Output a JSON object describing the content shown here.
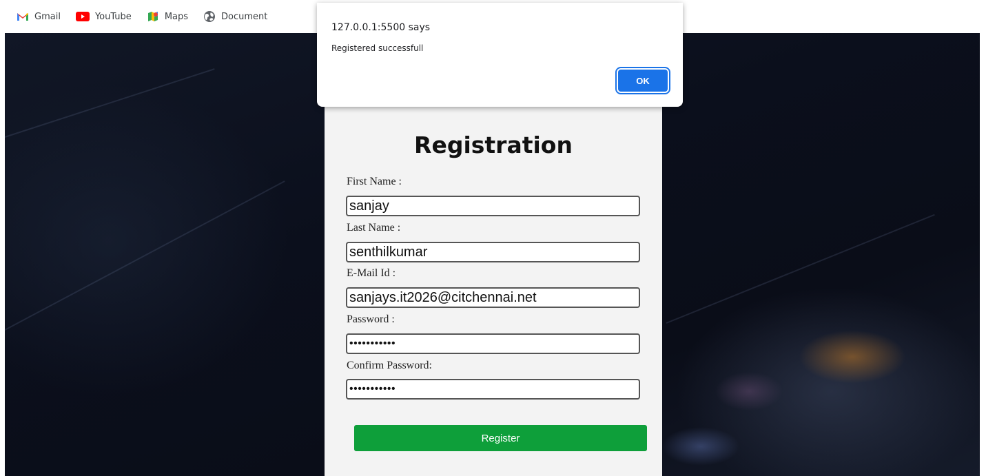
{
  "bookmarks": [
    {
      "label": "Gmail",
      "icon": "gmail-icon"
    },
    {
      "label": "YouTube",
      "icon": "youtube-icon"
    },
    {
      "label": "Maps",
      "icon": "maps-icon"
    },
    {
      "label": "Document",
      "icon": "globe-icon"
    }
  ],
  "dialog": {
    "title": "127.0.0.1:5500 says",
    "message": "Registered successfull",
    "ok_label": "OK"
  },
  "form": {
    "title": "Registration",
    "first_name": {
      "label": "First Name :",
      "value": "sanjay"
    },
    "last_name": {
      "label": "Last Name :",
      "value": "senthilkumar"
    },
    "email": {
      "label": "E-Mail Id :",
      "value": "sanjays.it2026@citchennai.net"
    },
    "password": {
      "label": "Password :",
      "value": "•••••••••••"
    },
    "confirm_password": {
      "label": "Confirm Password:",
      "value": "•••••••••••"
    },
    "register_label": "Register"
  },
  "colors": {
    "register_button": "#0e9f3a",
    "ok_button": "#1a73e8",
    "card_background": "#f3f3f3"
  }
}
